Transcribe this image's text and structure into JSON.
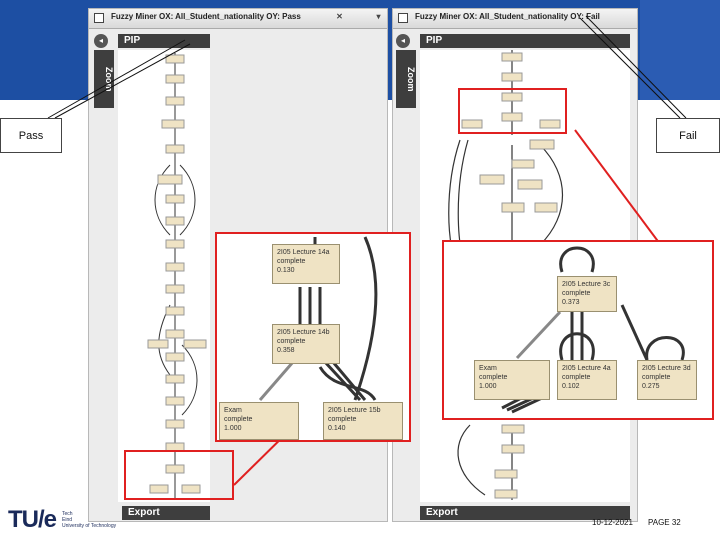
{
  "slide": {
    "callout_left": "Pass",
    "callout_right": "Fail",
    "date": "10-12-2021",
    "page_label": "PAGE 32",
    "logo_text": "TU/e",
    "logo_lines": [
      "Tech",
      "Eind",
      "University of Technology"
    ]
  },
  "left_window": {
    "title": "Fuzzy Miner OX: All_Student_nationality OY: Pass",
    "pip_label": "PIP",
    "zoom_label": "Zoom",
    "export_label": "Export"
  },
  "right_window": {
    "title": "Fuzzy Miner OX: All_Student_nationality OY: Fail",
    "pip_label": "PIP",
    "zoom_label": "Zoom",
    "export_label": "Export"
  },
  "zoom_left": {
    "nodes": [
      {
        "name": "2I05 Lecture 14a",
        "status": "complete",
        "value": "0.130"
      },
      {
        "name": "2I05 Lecture 14b",
        "status": "complete",
        "value": "0.358"
      },
      {
        "name": "Exam",
        "status": "complete",
        "value": "1.000"
      },
      {
        "name": "2I05 Lecture 15b",
        "status": "complete",
        "value": "0.140"
      }
    ]
  },
  "zoom_right": {
    "nodes": [
      {
        "name": "2I05 Lecture 3c",
        "status": "complete",
        "value": "0.373"
      },
      {
        "name": "Exam",
        "status": "complete",
        "value": "1.000"
      },
      {
        "name": "2I05 Lecture 4a",
        "status": "complete",
        "value": "0.102"
      },
      {
        "name": "2I05 Lecture 3d",
        "status": "complete",
        "value": "0.275"
      }
    ]
  }
}
